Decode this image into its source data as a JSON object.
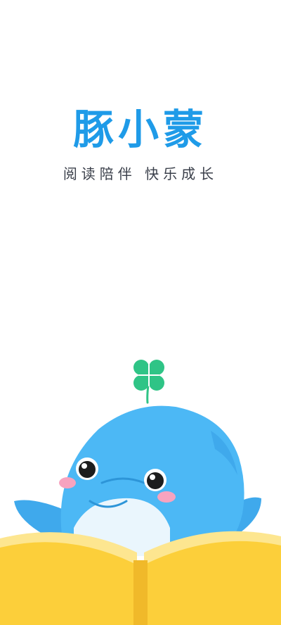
{
  "splash": {
    "title": "豚小蒙",
    "slogan": "阅读陪伴  快乐成长"
  },
  "colors": {
    "title": "#1f9be8",
    "slogan": "#3a3f4a",
    "dolphin_body": "#4cb8f5",
    "dolphin_belly": "#eaf6fd",
    "clover": "#2fc486",
    "cheek": "#f7a3bf",
    "book": "#fccf3a",
    "book_page": "#fde690"
  },
  "icons": {
    "mascot": "dolphin-reading-book-illustration",
    "clover": "four-leaf-clover-icon"
  }
}
